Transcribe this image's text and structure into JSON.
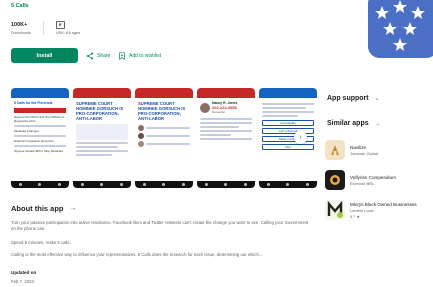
{
  "developer": "5 Calls",
  "stats": {
    "downloads_value": "100K+",
    "downloads_label": "Downloads",
    "rating_symbol": "E",
    "rating_label": "USK: All ages"
  },
  "actions": {
    "install_label": "Install",
    "share_label": "Share",
    "wishlist_label": "Add to wishlist"
  },
  "screenshots": {
    "s1": {
      "title": "5 Calls for the Florencia",
      "items": [
        "Support the DACA  and Stop Efforts to Repeal the ACA",
        "Medicaid Changes",
        "Defund Immigration Detention",
        "Oppose Senate Bill to Stop Medicare"
      ]
    },
    "s2": {
      "headline": "SUPREME COURT NOMINEE GORSUCH IS PRO-CORPORATION, ANTI-LABOR"
    },
    "s3": {
      "headline": "SUPREME COURT NOMINEE GORSUCH IS PRO-CORPORATION, ANTI-LABOR"
    },
    "s4": {
      "name": "Nancy R. Jones",
      "phone": "202-224-3553",
      "party": "Democrat"
    },
    "s5": {
      "buttons": [
        "Unavailable",
        "Left voicemail",
        "Made contact",
        "Skip"
      ]
    }
  },
  "about": {
    "title": "About this app",
    "para1": "Turn your passive participation into active resistance. Facebook likes and Twitter retweets can't create the change you want to see. Calling your Government on the phone can.",
    "para2": "Spend 5 minutes, make 5 calls.",
    "para3": "Calling is the most effective way to influence your representatives. 5 Calls does the research for each issue, determining our which...",
    "updated_label": "Updated on",
    "updated_value": "Feb 7, 2023"
  },
  "sidebar": {
    "app_support": "App support",
    "similar_title": "Similar apps",
    "apps": [
      {
        "name": "Navilize",
        "developer": "Joannah Global",
        "rating": ""
      },
      {
        "name": "Voflyrisn Compendium",
        "developer": "Exercise BRL",
        "rating": ""
      },
      {
        "name": "Minrys Black Owned Businesses",
        "developer": "Lamine Louiz",
        "rating": "4.7 ★"
      }
    ]
  },
  "colors": {
    "accent": "#01875f",
    "icon_blue": "#4b6fc4",
    "red": "#c62828",
    "blue_text": "#1e4fa3"
  }
}
